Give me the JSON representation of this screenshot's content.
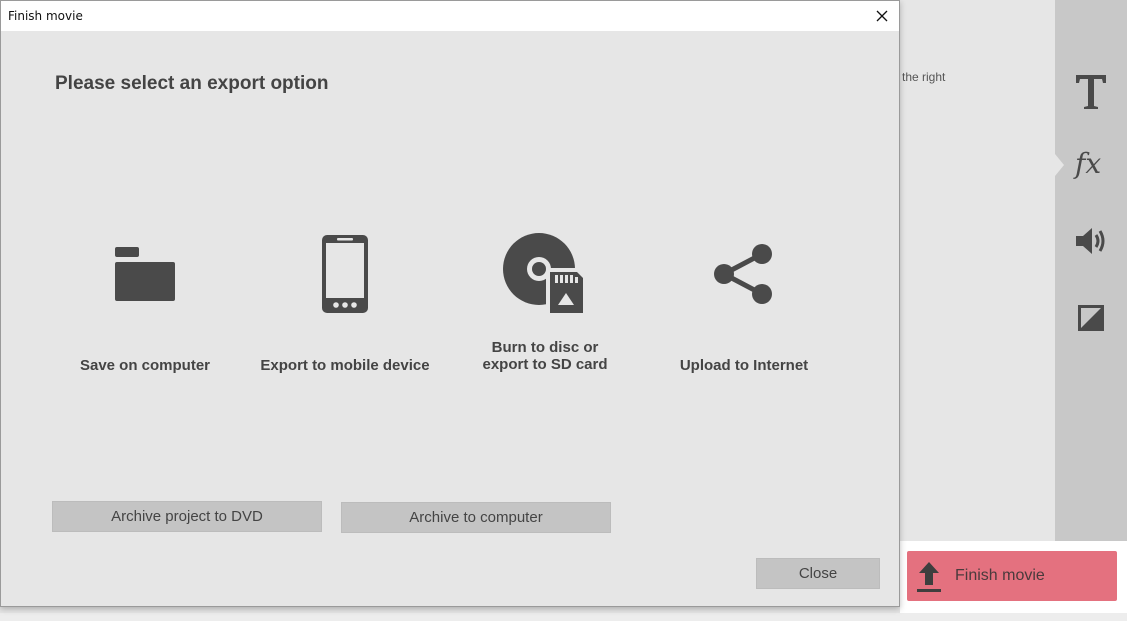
{
  "app": {
    "hint_text": "the right",
    "finish_button_label": "Finish movie",
    "toolbar": [
      {
        "name": "text-tool",
        "icon": "text-T-icon"
      },
      {
        "name": "effects-tool",
        "icon": "fx-icon"
      },
      {
        "name": "audio-tool",
        "icon": "speaker-icon"
      },
      {
        "name": "aspect-tool",
        "icon": "aspect-ratio-icon"
      }
    ],
    "colors": {
      "finish_accent": "#e4717f",
      "toolbar_bg": "#c8c8c8"
    }
  },
  "dialog": {
    "title": "Finish movie",
    "heading": "Please select an export option",
    "options": [
      {
        "label": "Save on computer",
        "icon": "folder-icon"
      },
      {
        "label": "Export to mobile device",
        "icon": "smartphone-icon"
      },
      {
        "label_line1": "Burn to disc or",
        "label_line2": "export to SD card",
        "icon": "disc-sd-card-icon"
      },
      {
        "label": "Upload to Internet",
        "icon": "share-icon"
      }
    ],
    "archive_dvd_label": "Archive project to DVD",
    "archive_computer_label": "Archive to computer",
    "close_label": "Close"
  }
}
